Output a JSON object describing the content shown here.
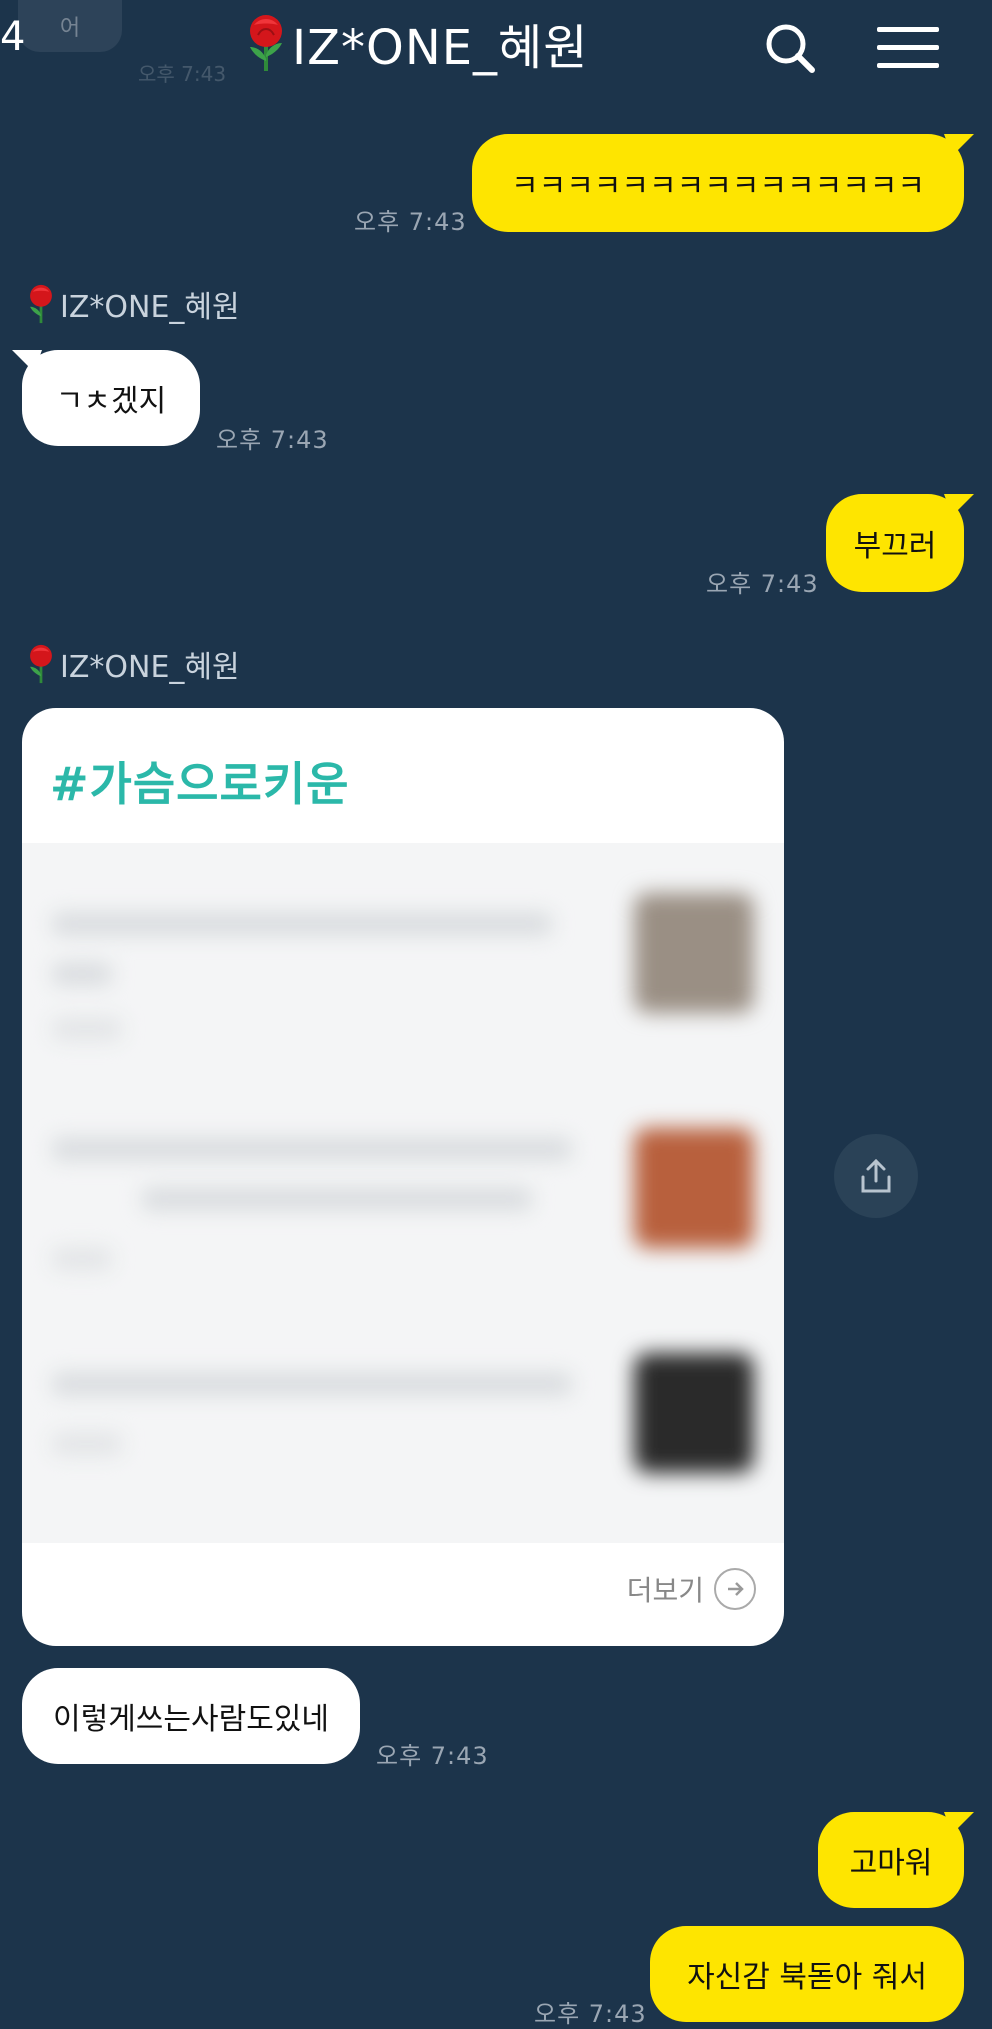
{
  "header": {
    "partial_left_text": "4",
    "title": "IZ*ONE_혜원",
    "top_ghost": {
      "bubble": "어",
      "time": "오후 7:43"
    }
  },
  "messages": {
    "m1": {
      "text": "ㅋㅋㅋㅋㅋㅋㅋㅋㅋㅋㅋㅋㅋㅋㅋ",
      "time": "오후 7:43"
    },
    "sender_name": "IZ*ONE_혜원",
    "m2": {
      "text": "ㄱㅊ겠지",
      "time": "오후 7:43"
    },
    "m3": {
      "text": "부끄러",
      "time": "오후 7:43"
    },
    "card": {
      "title": "#가슴으로키운",
      "more_label": "더보기"
    },
    "m4": {
      "text": "이렇게쓰는사람도있네",
      "time": "오후 7:43"
    },
    "m5": {
      "text": "고마워"
    },
    "m6": {
      "text": "자신감 북돋아 줘서",
      "time": "오후 7:43"
    }
  },
  "colors": {
    "background": "#1c344b",
    "yellow": "#fee500",
    "accent": "#2bb8a9"
  },
  "icons": {
    "search": "search-icon",
    "menu": "hamburger-menu-icon",
    "share": "share-icon",
    "rose": "rose-icon"
  }
}
